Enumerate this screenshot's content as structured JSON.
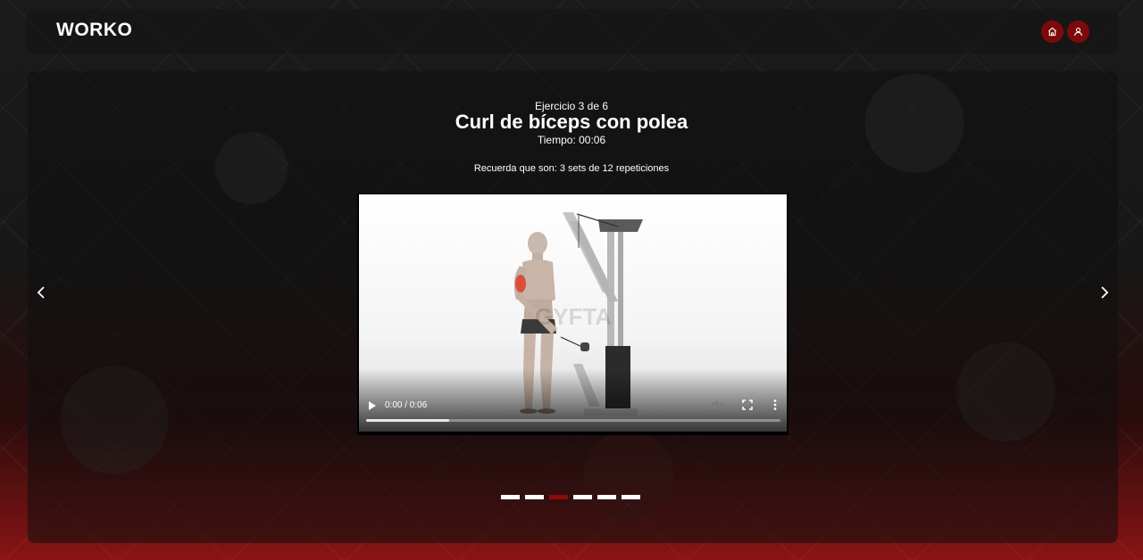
{
  "header": {
    "logo": "WORKO",
    "nav": [
      {
        "name": "home-icon",
        "label": "home"
      },
      {
        "name": "user-icon",
        "label": "profile"
      }
    ]
  },
  "exercise": {
    "counter": "Ejercicio 3 de 6",
    "title": "Curl de bíceps con polea",
    "timer": "Tiempo: 00:06",
    "reminder": "Recuerda que son: 3 sets de 12 repeticiones"
  },
  "video": {
    "time_display": "0:00 / 0:06",
    "progress": 0.2,
    "watermark": "GYFTA"
  },
  "carousel": {
    "total_slides": 6,
    "active_index": 2
  },
  "colors": {
    "accent": "#7d0a0a",
    "active_dot": "#8d0b0b"
  }
}
